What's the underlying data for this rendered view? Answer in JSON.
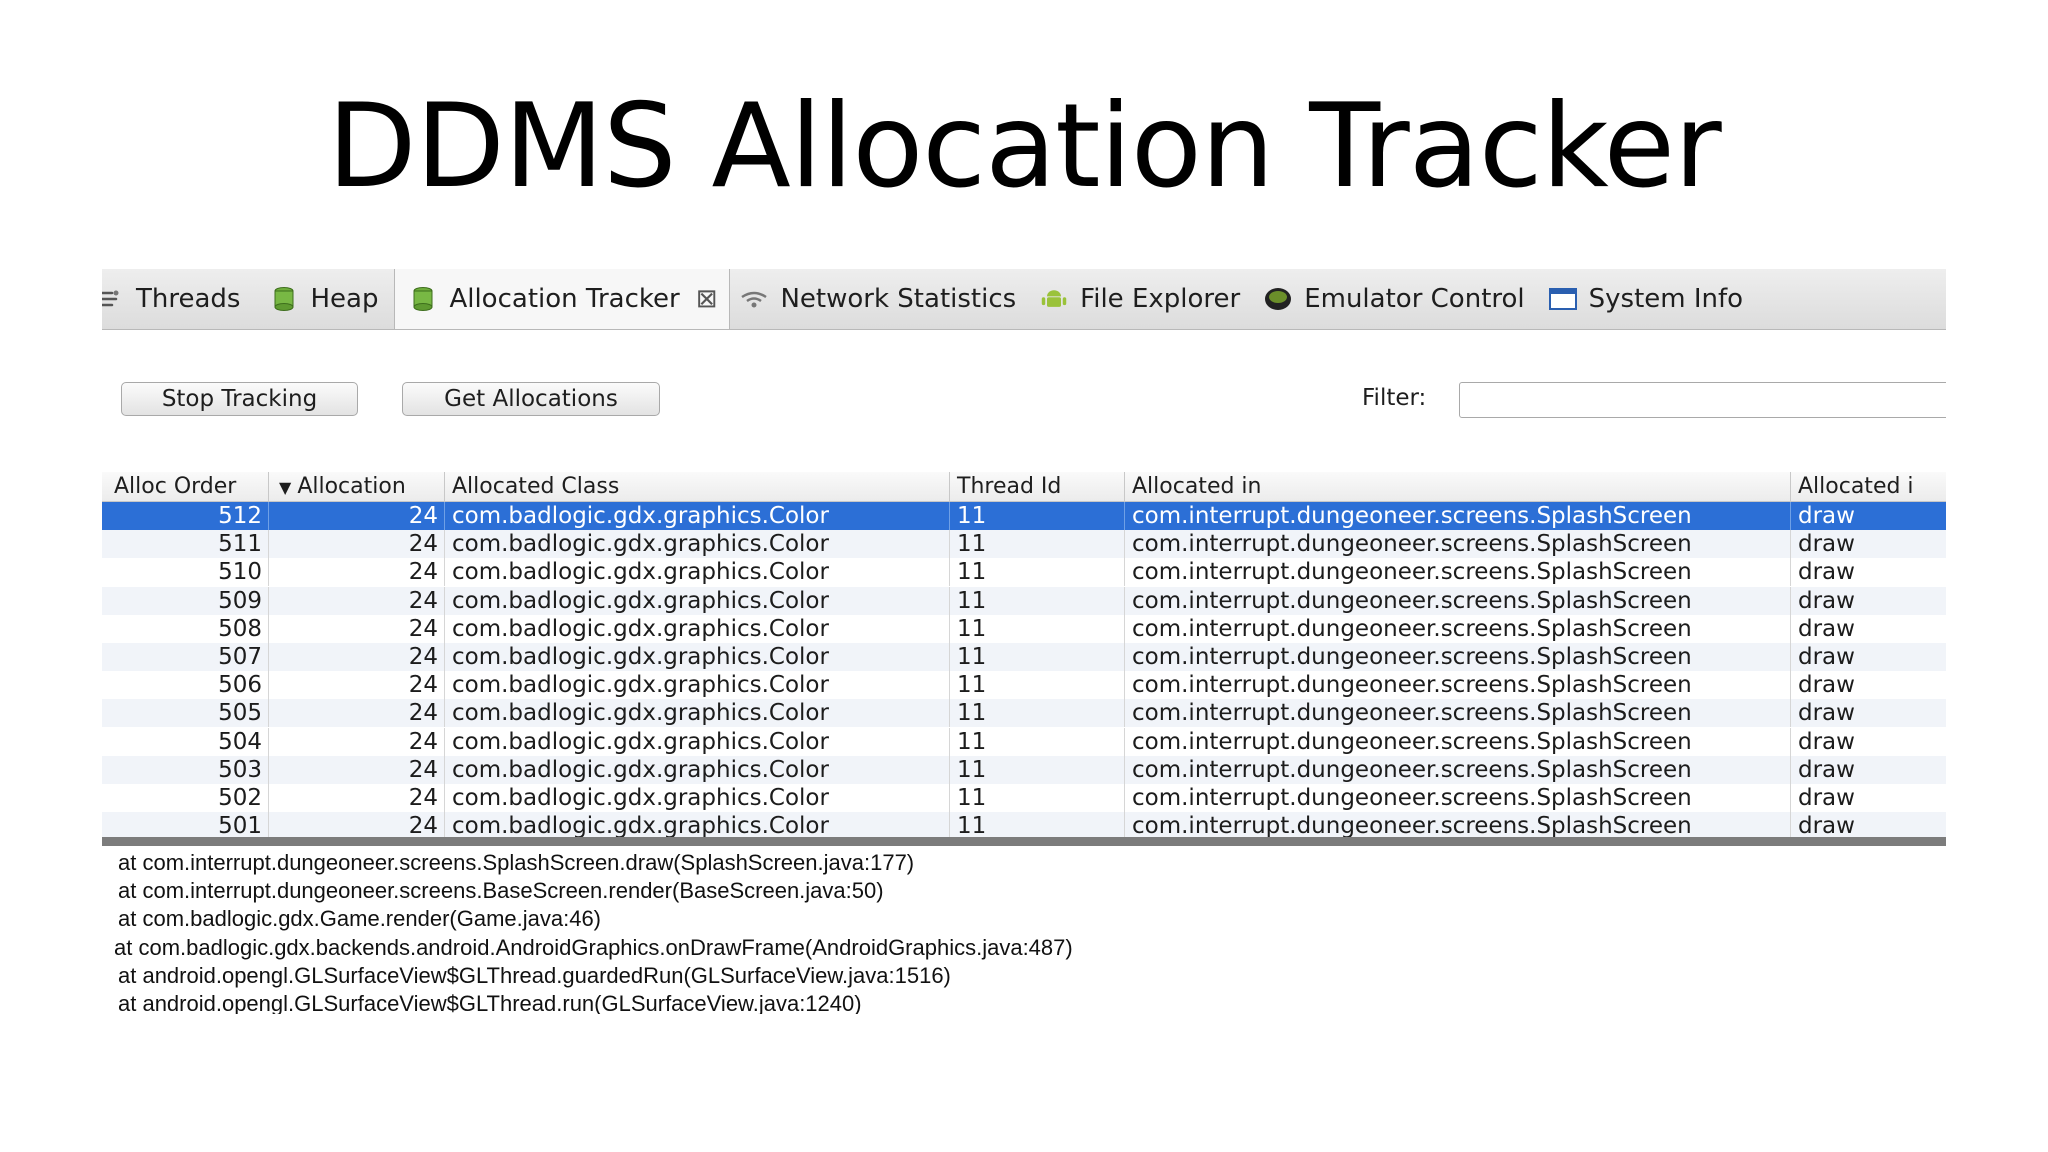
{
  "slide": {
    "title": "DDMS Allocation Tracker"
  },
  "tabs": [
    {
      "label": "Threads",
      "icon": "threads-icon"
    },
    {
      "label": "Heap",
      "icon": "heap-icon"
    },
    {
      "label": "Allocation Tracker",
      "icon": "allocation-icon",
      "active": true
    },
    {
      "label": "Network Statistics",
      "icon": "network-icon"
    },
    {
      "label": "File Explorer",
      "icon": "android-icon"
    },
    {
      "label": "Emulator Control",
      "icon": "emulator-icon"
    },
    {
      "label": "System Info",
      "icon": "system-info-icon"
    }
  ],
  "toolbar": {
    "stop_label": "Stop Tracking",
    "get_label": "Get Allocations",
    "filter_label": "Filter:",
    "filter_value": ""
  },
  "table": {
    "columns": [
      "Alloc Order",
      "Allocation",
      "Allocated Class",
      "Thread Id",
      "Allocated in",
      "Allocated i"
    ],
    "sorted_column": "Allocation",
    "rows": [
      [
        "512",
        "24",
        "com.badlogic.gdx.graphics.Color",
        "11",
        "com.interrupt.dungeoneer.screens.SplashScreen",
        "draw"
      ],
      [
        "511",
        "24",
        "com.badlogic.gdx.graphics.Color",
        "11",
        "com.interrupt.dungeoneer.screens.SplashScreen",
        "draw"
      ],
      [
        "510",
        "24",
        "com.badlogic.gdx.graphics.Color",
        "11",
        "com.interrupt.dungeoneer.screens.SplashScreen",
        "draw"
      ],
      [
        "509",
        "24",
        "com.badlogic.gdx.graphics.Color",
        "11",
        "com.interrupt.dungeoneer.screens.SplashScreen",
        "draw"
      ],
      [
        "508",
        "24",
        "com.badlogic.gdx.graphics.Color",
        "11",
        "com.interrupt.dungeoneer.screens.SplashScreen",
        "draw"
      ],
      [
        "507",
        "24",
        "com.badlogic.gdx.graphics.Color",
        "11",
        "com.interrupt.dungeoneer.screens.SplashScreen",
        "draw"
      ],
      [
        "506",
        "24",
        "com.badlogic.gdx.graphics.Color",
        "11",
        "com.interrupt.dungeoneer.screens.SplashScreen",
        "draw"
      ],
      [
        "505",
        "24",
        "com.badlogic.gdx.graphics.Color",
        "11",
        "com.interrupt.dungeoneer.screens.SplashScreen",
        "draw"
      ],
      [
        "504",
        "24",
        "com.badlogic.gdx.graphics.Color",
        "11",
        "com.interrupt.dungeoneer.screens.SplashScreen",
        "draw"
      ],
      [
        "503",
        "24",
        "com.badlogic.gdx.graphics.Color",
        "11",
        "com.interrupt.dungeoneer.screens.SplashScreen",
        "draw"
      ],
      [
        "502",
        "24",
        "com.badlogic.gdx.graphics.Color",
        "11",
        "com.interrupt.dungeoneer.screens.SplashScreen",
        "draw"
      ],
      [
        "501",
        "24",
        "com.badlogic.gdx.graphics.Color",
        "11",
        "com.interrupt.dungeoneer.screens.SplashScreen",
        "draw"
      ]
    ],
    "selected_row": 0
  },
  "stack_trace": [
    "at com.interrupt.dungeoneer.screens.SplashScreen.draw(SplashScreen.java:177)",
    "at com.interrupt.dungeoneer.screens.BaseScreen.render(BaseScreen.java:50)",
    "at com.badlogic.gdx.Game.render(Game.java:46)",
    "at com.badlogic.gdx.backends.android.AndroidGraphics.onDrawFrame(AndroidGraphics.java:487)",
    "at android.opengl.GLSurfaceView$GLThread.guardedRun(GLSurfaceView.java:1516)",
    "at android.opengl.GLSurfaceView$GLThread.run(GLSurfaceView.java:1240)"
  ],
  "colors": {
    "selection": "#2c6fd6",
    "row_alt": "#f1f4f9"
  }
}
